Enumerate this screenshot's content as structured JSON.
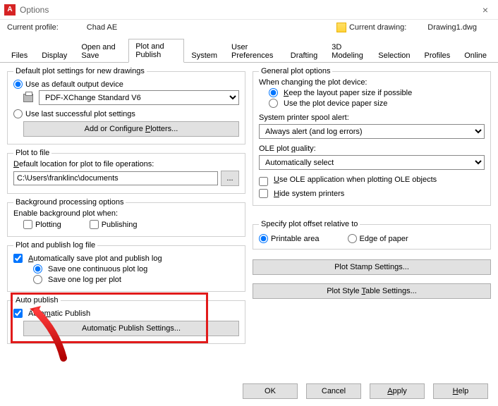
{
  "window": {
    "title": "Options",
    "close": "×"
  },
  "profile": {
    "label": "Current profile:",
    "value": "Chad AE",
    "drawing_label": "Current drawing:",
    "drawing_value": "Drawing1.dwg"
  },
  "tabs": [
    "Files",
    "Display",
    "Open and Save",
    "Plot and Publish",
    "System",
    "User Preferences",
    "Drafting",
    "3D Modeling",
    "Selection",
    "Profiles",
    "Online"
  ],
  "left": {
    "defaultPlot": {
      "legend": "Default plot settings for new drawings",
      "useDefault": "Use as default output device",
      "device": "PDF-XChange Standard V6",
      "useLast": "Use last successful plot settings",
      "configBtn": "Add or Configure Plotters..."
    },
    "plotToFile": {
      "legend": "Plot to file",
      "label": "Default location for plot to file operations:",
      "path": "C:\\Users\\franklinc\\documents"
    },
    "bg": {
      "legend": "Background processing options",
      "label": "Enable background plot when:",
      "plotting": "Plotting",
      "publishing": "Publishing"
    },
    "log": {
      "legend": "Plot and publish log file",
      "auto": "Automatically save plot and publish log",
      "one": "Save one continuous plot log",
      "per": "Save one log per plot"
    },
    "autopub": {
      "legend": "Auto publish",
      "check": "Automatic Publish",
      "btn": "Automatic Publish Settings..."
    }
  },
  "right": {
    "general": {
      "legend": "General plot options",
      "changing": "When changing the plot device:",
      "keep": "Keep the layout paper size if possible",
      "usedev": "Use the plot device paper size",
      "spoolLabel": "System printer spool alert:",
      "spoolValue": "Always alert (and log errors)",
      "oleLabel": "OLE plot quality:",
      "oleValue": "Automatically select",
      "useOle": "Use OLE application when plotting OLE objects",
      "hide": "Hide system printers"
    },
    "offset": {
      "legend": "Specify plot offset relative to",
      "printable": "Printable area",
      "edge": "Edge of paper"
    },
    "stampBtn": "Plot Stamp Settings...",
    "styleBtn": "Plot Style Table Settings..."
  },
  "footer": {
    "ok": "OK",
    "cancel": "Cancel",
    "apply": "Apply",
    "help": "Help"
  }
}
